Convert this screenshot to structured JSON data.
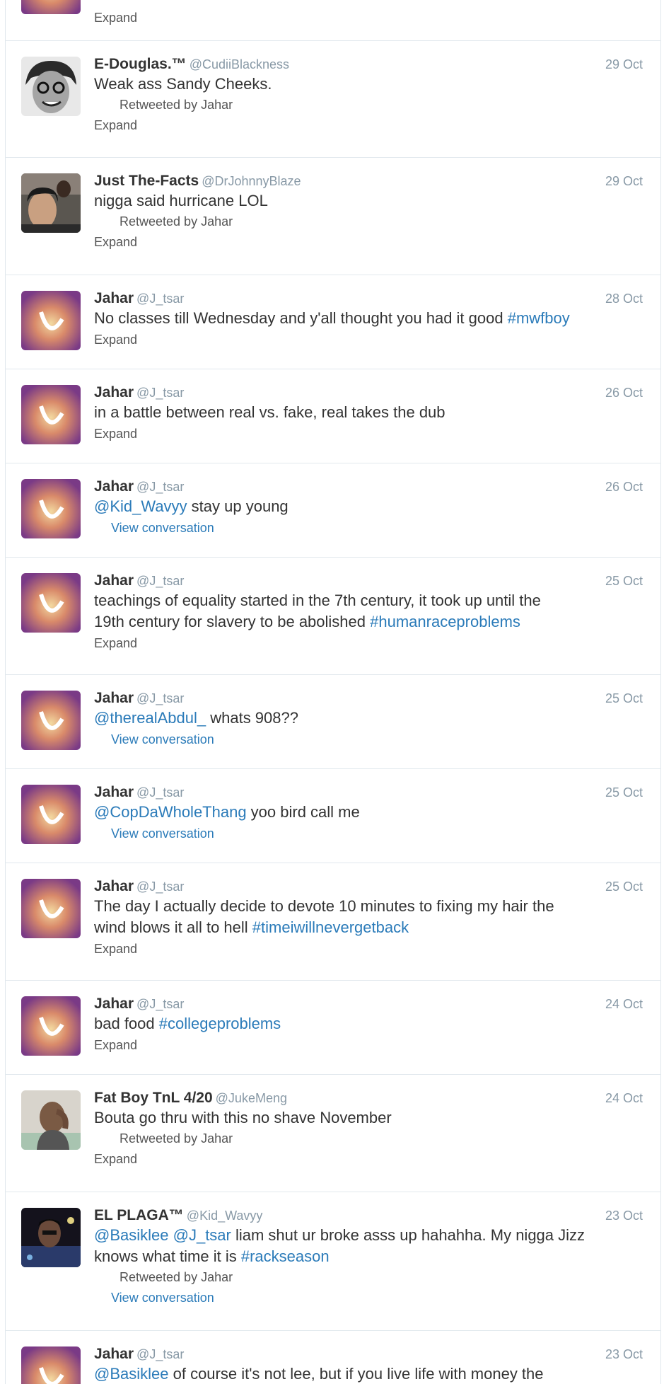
{
  "tweets": [
    {
      "expand_label": "Expand"
    },
    {
      "fullname": "E-Douglas.™",
      "username": "@CudiiBlackness",
      "time": "29 Oct",
      "text": "Weak ass Sandy Cheeks.",
      "retweeted_by": "Retweeted by Jahar",
      "action": "Expand"
    },
    {
      "fullname": "Just The-Facts",
      "username": "@DrJohnnyBlaze",
      "time": "29 Oct",
      "text": "nigga said hurricane LOL",
      "retweeted_by": "Retweeted by Jahar",
      "action": "Expand"
    },
    {
      "fullname": "Jahar",
      "username": "@J_tsar",
      "time": "28 Oct",
      "text": "No classes till Wednesday and y'all thought you had it good ",
      "hashtag": "#mwfboy",
      "action": "Expand"
    },
    {
      "fullname": "Jahar",
      "username": "@J_tsar",
      "time": "26 Oct",
      "text": "in a battle between real vs. fake, real takes the dub",
      "action": "Expand"
    },
    {
      "fullname": "Jahar",
      "username": "@J_tsar",
      "time": "26 Oct",
      "mention": "@Kid_Wavyy",
      "text": " stay up young",
      "action": "View conversation"
    },
    {
      "fullname": "Jahar",
      "username": "@J_tsar",
      "time": "25 Oct",
      "text_line1": "teachings of equality started in the 7th century, it took up until the",
      "text_line2": "19th century for slavery to be abolished ",
      "hashtag": "#humanraceproblems",
      "action": "Expand"
    },
    {
      "fullname": "Jahar",
      "username": "@J_tsar",
      "time": "25 Oct",
      "mention": "@therealAbdul_",
      "text": " whats 908??",
      "action": "View conversation"
    },
    {
      "fullname": "Jahar",
      "username": "@J_tsar",
      "time": "25 Oct",
      "mention": "@CopDaWholeThang",
      "text": " yoo bird call me",
      "action": "View conversation"
    },
    {
      "fullname": "Jahar",
      "username": "@J_tsar",
      "time": "25 Oct",
      "text_line1": "The day I actually decide to devote 10 minutes to fixing my hair the",
      "text_line2": "wind blows it all to hell ",
      "hashtag": "#timeiwillnevergetback",
      "action": "Expand"
    },
    {
      "fullname": "Jahar",
      "username": "@J_tsar",
      "time": "24 Oct",
      "text": "bad food ",
      "hashtag": "#collegeproblems",
      "action": "Expand"
    },
    {
      "fullname": "Fat Boy TnL 4/20",
      "username": "@JukeMeng",
      "time": "24 Oct",
      "text": "Bouta go thru with this no shave November",
      "retweeted_by": "Retweeted by Jahar",
      "action": "Expand"
    },
    {
      "fullname": "EL PLAGA™",
      "username": "@Kid_Wavyy",
      "time": "23 Oct",
      "mention1": "@Basiklee",
      "mention2": "@J_tsar",
      "text_line1": " liam shut ur broke asss up hahahha. My nigga Jizz",
      "text_line2": "knows what time it is ",
      "hashtag": "#rackseason",
      "retweeted_by": "Retweeted by Jahar",
      "action": "View conversation"
    },
    {
      "fullname": "Jahar",
      "username": "@J_tsar",
      "time": "23 Oct",
      "mention": "@Basiklee",
      "text": " of course it's not lee, but if you live life with money the"
    }
  ]
}
